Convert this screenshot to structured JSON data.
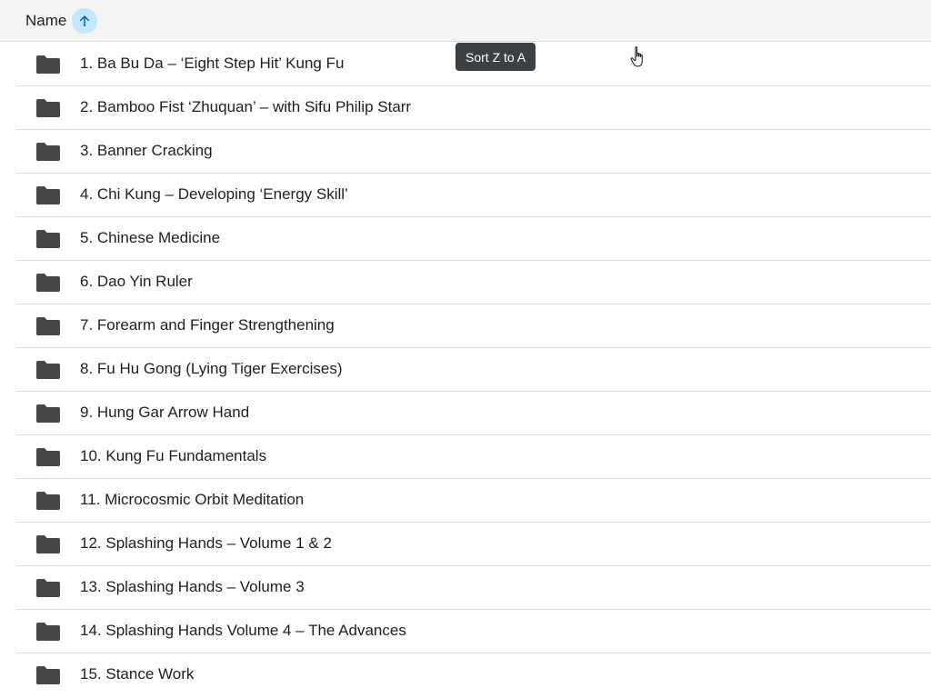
{
  "header": {
    "name_label": "Name",
    "sort_icon": "arrow-up-icon",
    "sort_direction": "ascending",
    "accent_color": "#c2e7ff"
  },
  "tooltip": {
    "text": "Sort Z to A"
  },
  "folder_icon": "folder-icon",
  "rows": [
    {
      "label": "1. Ba Bu Da – ‘Eight Step Hit’ Kung Fu"
    },
    {
      "label": "2. Bamboo Fist ‘Zhuquan’ – with Sifu Philip Starr"
    },
    {
      "label": "3. Banner Cracking"
    },
    {
      "label": "4. Chi Kung – Developing ‘Energy Skill’"
    },
    {
      "label": "5. Chinese Medicine"
    },
    {
      "label": "6. Dao Yin Ruler"
    },
    {
      "label": "7. Forearm and Finger Strengthening"
    },
    {
      "label": "8. Fu Hu Gong (Lying Tiger Exercises)"
    },
    {
      "label": "9. Hung Gar Arrow Hand"
    },
    {
      "label": "10. Kung Fu Fundamentals"
    },
    {
      "label": "11. Microcosmic Orbit Meditation"
    },
    {
      "label": "12. Splashing Hands – Volume 1 & 2"
    },
    {
      "label": "13. Splashing Hands – Volume 3"
    },
    {
      "label": "14. Splashing Hands Volume 4 – The Advances"
    },
    {
      "label": "15. Stance Work"
    }
  ]
}
